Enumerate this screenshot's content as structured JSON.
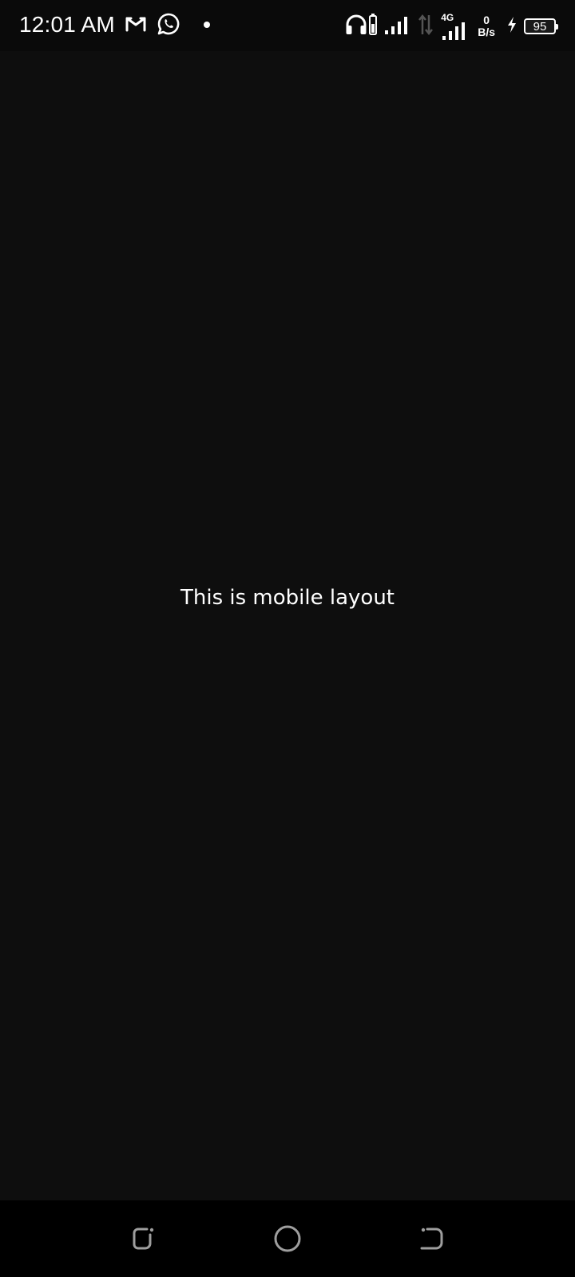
{
  "status_bar": {
    "time": "12:01 AM",
    "notification_icons": [
      "gmail-icon",
      "whatsapp-icon",
      "more-notifications-dot-icon"
    ],
    "network_type": "4G",
    "speed_value": "0",
    "speed_unit": "B/s",
    "battery_level": "95",
    "charging": true
  },
  "content": {
    "message": "This is mobile layout"
  },
  "nav_bar": {
    "buttons": [
      "recent-apps",
      "home",
      "back"
    ]
  },
  "colors": {
    "background": "#0e0e0e",
    "status_bar": "#0a0a0a",
    "nav_bar": "#000000",
    "text": "#ffffff"
  }
}
